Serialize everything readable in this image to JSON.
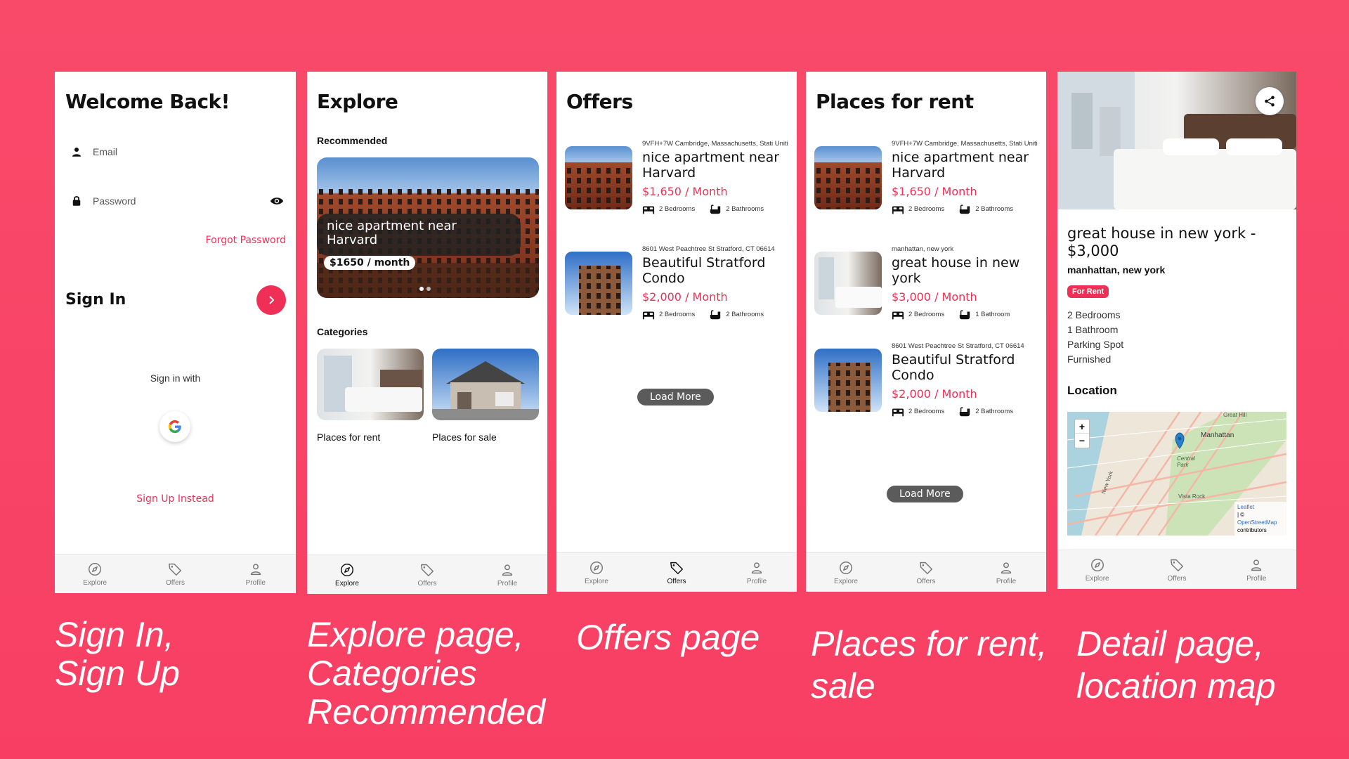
{
  "nav": {
    "explore": "Explore",
    "offers": "Offers",
    "profile": "Profile"
  },
  "signin": {
    "title": "Welcome Back!",
    "email_label": "Email",
    "password_label": "Password",
    "forgot": "Forgot Password",
    "sign_in": "Sign In",
    "sign_in_with": "Sign in with",
    "sign_up": "Sign Up Instead"
  },
  "explore": {
    "title": "Explore",
    "recommended": "Recommended",
    "hero_title": "nice apartment near Harvard",
    "hero_price": "$1650 / month",
    "categories": "Categories",
    "cat_rent": "Places for rent",
    "cat_sale": "Places for sale"
  },
  "offers": {
    "title": "Offers",
    "load_more": "Load More",
    "items": [
      {
        "addr": "9VFH+7W Cambridge, Massachusetts, Stati Uniti",
        "title": "nice apartment near Harvard",
        "price": "$1,650 / Month",
        "beds": "2 Bedrooms",
        "baths": "2 Bathrooms"
      },
      {
        "addr": "8601 West Peachtree St Stratford, CT 06614",
        "title": "Beautiful Stratford Condo",
        "price": "$2,000 / Month",
        "beds": "2 Bedrooms",
        "baths": "2 Bathrooms"
      }
    ]
  },
  "rent": {
    "title": "Places for rent",
    "load_more": "Load More",
    "items": [
      {
        "addr": "9VFH+7W Cambridge, Massachusetts, Stati Uniti",
        "title": "nice apartment near Harvard",
        "price": "$1,650 / Month",
        "beds": "2 Bedrooms",
        "baths": "2 Bathrooms"
      },
      {
        "addr": "manhattan, new york",
        "title": "great house in new york",
        "price": "$3,000 / Month",
        "beds": "2 Bedrooms",
        "baths": "1 Bathroom"
      },
      {
        "addr": "8601 West Peachtree St Stratford, CT 06614",
        "title": "Beautiful Stratford Condo",
        "price": "$2,000 / Month",
        "beds": "2 Bedrooms",
        "baths": "2 Bathrooms"
      }
    ]
  },
  "detail": {
    "title": "great house in new york - $3,000",
    "location_text": "manhattan, new york",
    "badge": "For Rent",
    "features": [
      "2 Bedrooms",
      "1 Bathroom",
      "Parking Spot",
      "Furnished"
    ],
    "location_heading": "Location",
    "zoom_in": "+",
    "zoom_out": "−",
    "map_labels": {
      "manhattan": "Manhattan",
      "central_park": "Central Park",
      "vista_rock": "Vista Rock",
      "great_hill": "Great Hill",
      "new_york": "New York"
    },
    "attribution": [
      "Leaflet",
      "| ©",
      "OpenStreetMap",
      "contributors"
    ]
  },
  "captions": {
    "c1": [
      "Sign In,",
      "Sign Up"
    ],
    "c2": [
      "Explore page,",
      "Categories",
      "Recommended"
    ],
    "c3": [
      "Offers page"
    ],
    "c4": [
      "Places for rent,",
      "sale"
    ],
    "c5": [
      "Detail page,",
      "location map"
    ]
  },
  "colors": {
    "accent": "#ef2f56",
    "background": "#f94a6a"
  }
}
